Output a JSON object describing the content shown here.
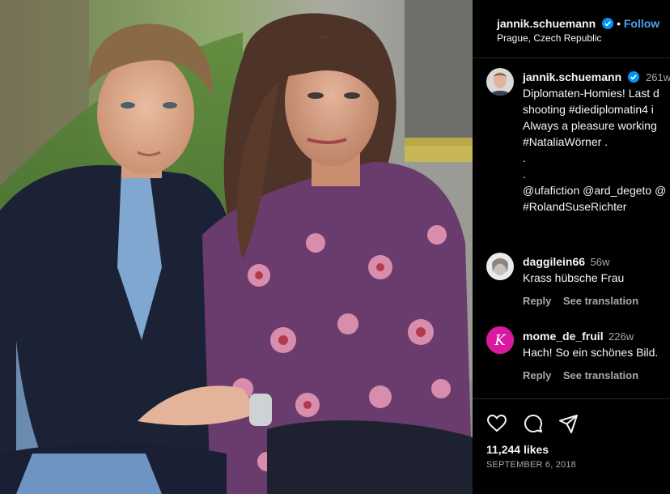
{
  "post": {
    "username": "jannik.schuemann",
    "follow_label": "Follow",
    "location": "Prague, Czech Republic"
  },
  "caption": {
    "username": "jannik.schuemann",
    "time": "261w",
    "lines": [
      "Diplomaten-Homies! Last d",
      "shooting #diediplomatin4 i",
      "Always a pleasure working",
      "#NataliaWörner .",
      ".",
      ".",
      "@ufafiction @ard_degeto @",
      "#RolandSuseRichter"
    ]
  },
  "comments": [
    {
      "username": "daggilein66",
      "time": "56w",
      "text": "Krass hübsche Frau",
      "reply_label": "Reply",
      "translate_label": "See translation"
    },
    {
      "username": "mome_de_fruil",
      "time": "226w",
      "text": "Hach! So ein schönes Bild.",
      "reply_label": "Reply",
      "translate_label": "See translation"
    }
  ],
  "stats": {
    "likes": "11,244 likes",
    "date": "SEPTEMBER 6, 2018"
  },
  "colors": {
    "verified": "#0095f6",
    "follow": "#4aa3f0",
    "background": "#000000"
  },
  "icons": [
    "verified-icon",
    "heart-icon",
    "comment-icon",
    "share-icon"
  ]
}
